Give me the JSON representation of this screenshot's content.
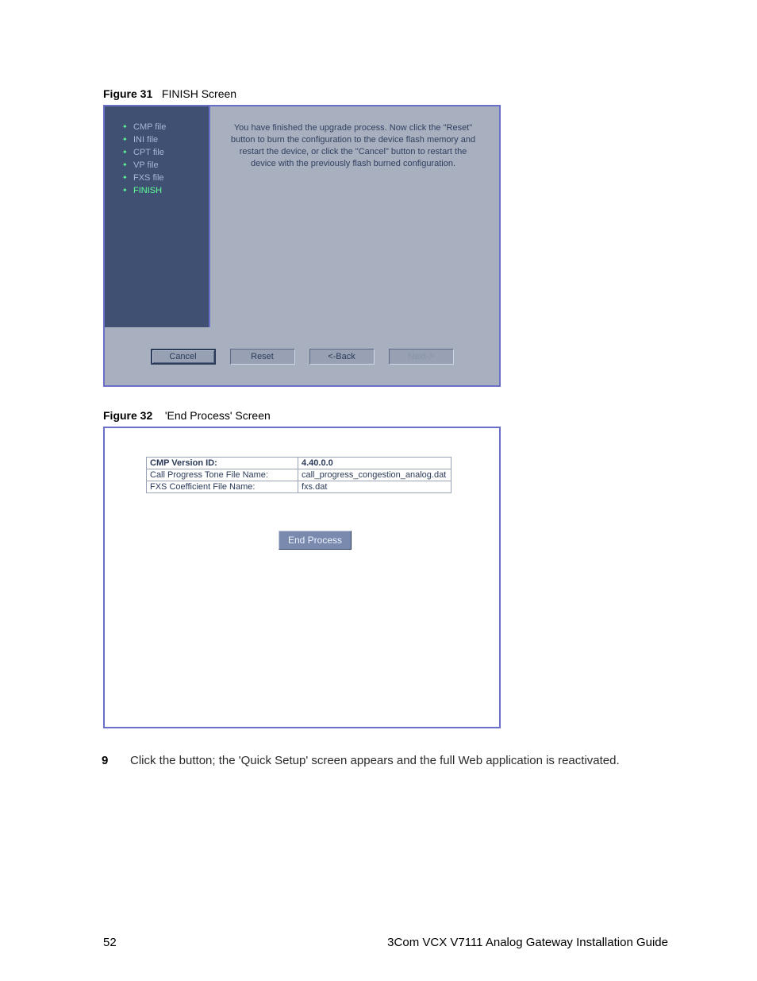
{
  "captions": {
    "fig31_num": "Figure 31",
    "fig31_title": "FINISH Screen",
    "fig32_num": "Figure 32",
    "fig32_title": "'End Process' Screen"
  },
  "fig31": {
    "sidebar": {
      "items": [
        {
          "label": "CMP file"
        },
        {
          "label": "INI file"
        },
        {
          "label": "CPT file"
        },
        {
          "label": "VP file"
        },
        {
          "label": "FXS file"
        },
        {
          "label": "FINISH"
        }
      ]
    },
    "message_l1": "You have finished the upgrade process. Now click the \"Reset\"",
    "message_l2": "button to burn the configuration to the device flash memory and",
    "message_l3": "restart the device, or click the \"Cancel\" button to restart the",
    "message_l4": "device with the previously flash burned configuration.",
    "buttons": {
      "cancel": "Cancel",
      "reset": "Reset",
      "back": "<-Back",
      "next": "Next->"
    }
  },
  "fig32": {
    "rows": [
      {
        "label": "CMP Version ID:",
        "value": "4.40.0.0"
      },
      {
        "label": "Call Progress Tone File Name:",
        "value": "call_progress_congestion_analog.dat"
      },
      {
        "label": "FXS Coefficient File Name:",
        "value": "fxs.dat"
      }
    ],
    "button": "End Process"
  },
  "step9": {
    "num": "9",
    "text": "Click the                    button; the 'Quick Setup' screen appears and the full Web application is reactivated."
  },
  "footer": {
    "page": "52",
    "title": "3Com VCX V7111 Analog Gateway Installation Guide"
  }
}
